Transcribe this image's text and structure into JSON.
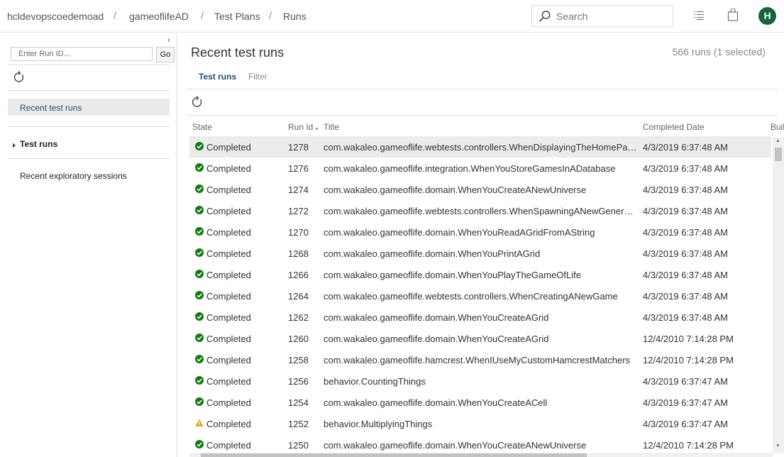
{
  "breadcrumb": {
    "org": "hcldevopscoedemoad",
    "project": "gameoflifeAD",
    "section": "Test Plans",
    "page": "Runs",
    "separator": "/"
  },
  "header": {
    "search_placeholder": "Search",
    "avatar_initial": "H",
    "avatar_color": "#14643c"
  },
  "left": {
    "collapse_glyph": "‹",
    "run_id_placeholder": "Enter Run ID...",
    "go_label": "Go",
    "recent_test_runs": "Recent test runs",
    "test_runs": "Test runs",
    "recent_exploratory": "Recent exploratory sessions"
  },
  "main": {
    "title": "Recent test runs",
    "count_text": "566 runs (1 selected)",
    "tabs": [
      {
        "label": "Test runs",
        "active": true
      },
      {
        "label": "Filter",
        "active": false
      }
    ],
    "columns": {
      "state": "State",
      "run_id": "Run Id",
      "title": "Title",
      "completed_date": "Completed Date",
      "build": "Build"
    },
    "rows": [
      {
        "status": "passed",
        "state": "Completed",
        "id": "1278",
        "title": "com.wakaleo.gameoflife.webtests.controllers.WhenDisplayingTheHomePage",
        "date": "4/3/2019 6:37:48 AM",
        "selected": true
      },
      {
        "status": "passed",
        "state": "Completed",
        "id": "1276",
        "title": "com.wakaleo.gameoflife.integration.WhenYouStoreGamesInADatabase",
        "date": "4/3/2019 6:37:48 AM"
      },
      {
        "status": "passed",
        "state": "Completed",
        "id": "1274",
        "title": "com.wakaleo.gameoflife.domain.WhenYouCreateANewUniverse",
        "date": "4/3/2019 6:37:48 AM"
      },
      {
        "status": "passed",
        "state": "Completed",
        "id": "1272",
        "title": "com.wakaleo.gameoflife.webtests.controllers.WhenSpawningANewGenerati...",
        "date": "4/3/2019 6:37:48 AM"
      },
      {
        "status": "passed",
        "state": "Completed",
        "id": "1270",
        "title": "com.wakaleo.gameoflife.domain.WhenYouReadAGridFromAString",
        "date": "4/3/2019 6:37:48 AM"
      },
      {
        "status": "passed",
        "state": "Completed",
        "id": "1268",
        "title": "com.wakaleo.gameoflife.domain.WhenYouPrintAGrid",
        "date": "4/3/2019 6:37:48 AM"
      },
      {
        "status": "passed",
        "state": "Completed",
        "id": "1266",
        "title": "com.wakaleo.gameoflife.domain.WhenYouPlayTheGameOfLife",
        "date": "4/3/2019 6:37:48 AM"
      },
      {
        "status": "passed",
        "state": "Completed",
        "id": "1264",
        "title": "com.wakaleo.gameoflife.webtests.controllers.WhenCreatingANewGame",
        "date": "4/3/2019 6:37:48 AM"
      },
      {
        "status": "passed",
        "state": "Completed",
        "id": "1262",
        "title": "com.wakaleo.gameoflife.domain.WhenYouCreateAGrid",
        "date": "4/3/2019 6:37:48 AM"
      },
      {
        "status": "passed",
        "state": "Completed",
        "id": "1260",
        "title": "com.wakaleo.gameoflife.domain.WhenYouCreateAGrid",
        "date": "12/4/2010 7:14:28 PM"
      },
      {
        "status": "passed",
        "state": "Completed",
        "id": "1258",
        "title": "com.wakaleo.gameoflife.hamcrest.WhenIUseMyCustomHamcrestMatchers",
        "date": "12/4/2010 7:14:28 PM"
      },
      {
        "status": "passed",
        "state": "Completed",
        "id": "1256",
        "title": "behavior.CountingThings",
        "date": "4/3/2019 6:37:47 AM"
      },
      {
        "status": "passed",
        "state": "Completed",
        "id": "1254",
        "title": "com.wakaleo.gameoflife.domain.WhenYouCreateACell",
        "date": "4/3/2019 6:37:47 AM"
      },
      {
        "status": "warning",
        "state": "Completed",
        "id": "1252",
        "title": "behavior.MultiplyingThings",
        "date": "4/3/2019 6:37:47 AM"
      },
      {
        "status": "passed",
        "state": "Completed",
        "id": "1250",
        "title": "com.wakaleo.gameoflife.domain.WhenYouCreateANewUniverse",
        "date": "12/4/2010 7:14:28 PM"
      }
    ]
  },
  "colors": {
    "passed": "#107c10",
    "warning": "#e8a317",
    "accent": "#1e4f7a"
  }
}
